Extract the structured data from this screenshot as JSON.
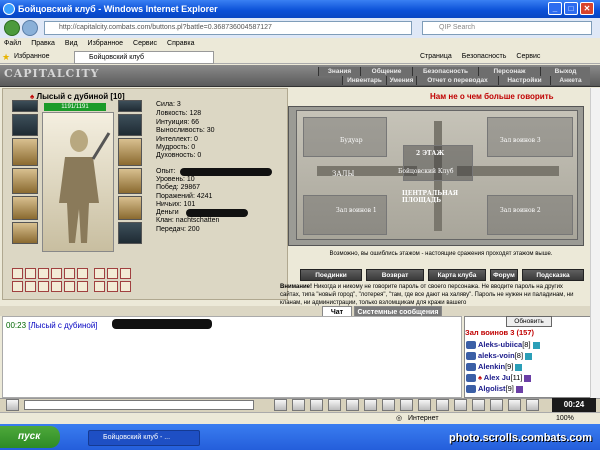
{
  "window": {
    "title": "Бойцовский клуб - Windows Internet Explorer"
  },
  "addressbar": {
    "url": "http://capitalcity.combats.com/buttons.pl?battle=0.368736004587127",
    "search_placeholder": "QIP Search"
  },
  "menu": [
    "Файл",
    "Правка",
    "Вид",
    "Избранное",
    "Сервис",
    "Справка"
  ],
  "tabs": {
    "favorites": "Избранное",
    "active_tab": "Бойцовский клуб",
    "tools": [
      "Страница",
      "Безопасность",
      "Сервис"
    ]
  },
  "game": {
    "logo": "CAPITALCITY",
    "nav_top": [
      "Знания",
      "Общение",
      "Безопасность",
      "Персонаж",
      "Выход"
    ],
    "nav_bottom": [
      "Инвентарь",
      "Умения",
      "Отчет о переводах",
      "Настройки",
      "Анкета"
    ],
    "headline": "Нам не о чем больше говорить"
  },
  "character": {
    "name": "Лысый с дубиной",
    "level": "[10]",
    "hp": "1191/1191",
    "stats": [
      {
        "label": "Сила: 3"
      },
      {
        "label": "Ловкость: 128"
      },
      {
        "label": "Интуиция: 66"
      },
      {
        "label": "Выносливость: 30"
      },
      {
        "label": "Интеллект: 0"
      },
      {
        "label": "Мудрость: 0"
      },
      {
        "label": "Духовность: 0"
      }
    ],
    "info": [
      {
        "label": "Опыт:"
      },
      {
        "label": "Уровень: 10"
      },
      {
        "label": "Побед: 29867"
      },
      {
        "label": "Поражений: 4241"
      },
      {
        "label": "Ничьих: 101"
      },
      {
        "label": "Деньги"
      },
      {
        "label": "Клан: nachtschatten"
      },
      {
        "label": "Передач: 200"
      }
    ]
  },
  "map": {
    "labels": [
      "Будуар",
      "Зал воинов 3",
      "2 ЭТАЖ",
      "Бойцовский Клуб",
      "ЗАЛЫ",
      "ЦЕНТРАЛЬНАЯ ПЛОЩАДЬ",
      "Зал воинов 1",
      "Зал воинов 2"
    ],
    "note": "Возможно, вы ошиблись этажом - настоящие сражения проходят этажом выше."
  },
  "buttons": [
    "Поединки",
    "Возврат",
    "Карта клуба",
    "Форум",
    "Подсказка"
  ],
  "warning": {
    "title": "Внимание!",
    "text": "Никогда и никому не говорите пароль от своего персонажа. Не вводите пароль на других сайтах, типа \"новый город\", \"лотерея\", \"там, где все дают на халяву\". Пароль не нужен ни паладинам, ни кланам, ни администрации, только взломщикам для кражи вашего"
  },
  "chat": {
    "tabs": [
      "Чат",
      "Системные сообщения"
    ],
    "time": "00:23",
    "message": "[Лысый с дубиной]"
  },
  "room": {
    "refresh": "Обновить",
    "title": "Зал воинов 3 (157)",
    "users": [
      {
        "name": "Aleks-ubiica",
        "level": "[8]"
      },
      {
        "name": "aleks-voin",
        "level": "[8]"
      },
      {
        "name": "Alenkin",
        "level": "[9]"
      },
      {
        "name": "Alex Ju",
        "level": "[11]"
      },
      {
        "name": "Algolist",
        "level": "[9]"
      }
    ]
  },
  "clock": "00:24",
  "status": {
    "zone": "Интернет",
    "zoom": "100%"
  },
  "taskbar": {
    "start": "пуск",
    "item": "Бойцовский клуб - ..."
  },
  "watermark": "photo.scrolls.combats.com"
}
